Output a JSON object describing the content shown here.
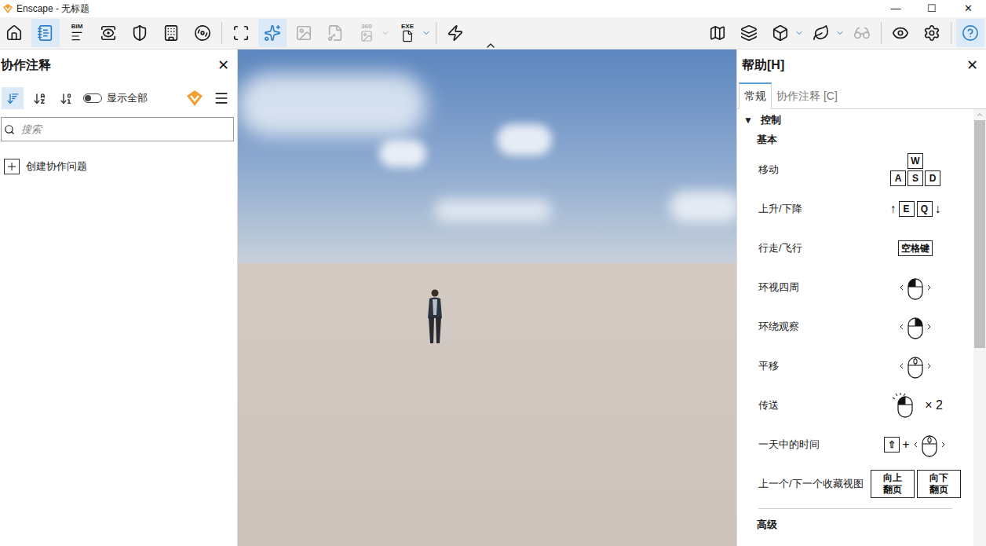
{
  "window": {
    "title": "Enscape - 无标题",
    "controls": [
      "—",
      "☐",
      "✕"
    ]
  },
  "toolbar": {
    "left": [
      [
        {
          "selected": false,
          "disabled": false,
          "dropdown": false
        },
        {
          "selected": true,
          "disabled": false,
          "dropdown": false
        },
        {
          "selected": false,
          "disabled": false,
          "dropdown": false,
          "label": "BIM"
        },
        {
          "selected": false,
          "disabled": false,
          "dropdown": false
        },
        {
          "selected": false,
          "disabled": false,
          "dropdown": false
        },
        {
          "selected": false,
          "disabled": false,
          "dropdown": false
        },
        {
          "selected": false,
          "disabled": false,
          "dropdown": false
        }
      ],
      [
        {
          "selected": false,
          "disabled": false,
          "dropdown": false
        },
        {
          "selected": true,
          "disabled": false,
          "dropdown": false
        },
        {
          "selected": false,
          "disabled": true,
          "dropdown": false
        },
        {
          "selected": false,
          "disabled": true,
          "dropdown": false
        },
        {
          "selected": false,
          "disabled": true,
          "dropdown": true,
          "label": "360"
        },
        {
          "selected": false,
          "disabled": false,
          "dropdown": true,
          "label": "EXE"
        }
      ],
      [
        {
          "selected": false,
          "disabled": false,
          "dropdown": false
        }
      ]
    ],
    "right": [
      [
        {
          "selected": false,
          "disabled": false,
          "dropdown": false
        },
        {
          "selected": false,
          "disabled": false,
          "dropdown": false
        },
        {
          "selected": false,
          "disabled": false,
          "dropdown": true
        },
        {
          "selected": false,
          "disabled": false,
          "dropdown": true
        },
        {
          "selected": false,
          "disabled": true,
          "dropdown": false
        }
      ],
      [
        {
          "selected": false,
          "disabled": false,
          "dropdown": false
        },
        {
          "selected": false,
          "disabled": false,
          "dropdown": false
        }
      ],
      [
        {
          "selected": true,
          "disabled": false,
          "dropdown": false
        }
      ]
    ]
  },
  "left_panel": {
    "title": "协作注释",
    "close": "✕",
    "sort": [
      {
        "selected": true
      },
      {
        "selected": false
      },
      {
        "selected": false
      }
    ],
    "show_all": {
      "label": "显示全部",
      "on": false
    },
    "search": {
      "placeholder": "搜索"
    },
    "create": "创建协作问题"
  },
  "help_panel": {
    "title": "帮助[H]",
    "close": "✕",
    "tabs": [
      {
        "label": "常规",
        "selected": true
      },
      {
        "label": "协作注释 [C]",
        "selected": false
      }
    ],
    "section": {
      "label": "控制",
      "marker": "▼",
      "expanded": true
    },
    "group": "基本",
    "rows": [
      {
        "label": "移动",
        "controls": [
          {
            "kind": "wasd",
            "top": "W",
            "bottom": [
              "A",
              "S",
              "D"
            ]
          }
        ]
      },
      {
        "label": "上升/下降",
        "controls": [
          {
            "kind": "text",
            "text": "↑"
          },
          {
            "kind": "key",
            "text": "E"
          },
          {
            "kind": "key",
            "text": "Q"
          },
          {
            "kind": "text",
            "text": "↓"
          }
        ]
      },
      {
        "label": "行走/飞行",
        "controls": [
          {
            "kind": "key",
            "text": "空格键"
          }
        ]
      },
      {
        "label": "环视四周",
        "controls": [
          {
            "kind": "mouse",
            "button": "left",
            "drag": true,
            "clicks": false
          }
        ]
      },
      {
        "label": "环绕观察",
        "controls": [
          {
            "kind": "mouse",
            "button": "right",
            "drag": true,
            "clicks": false
          }
        ]
      },
      {
        "label": "平移",
        "controls": [
          {
            "kind": "mouse",
            "button": "middle",
            "drag": true,
            "clicks": false
          }
        ]
      },
      {
        "label": "传送",
        "controls": [
          {
            "kind": "mouse",
            "button": "left",
            "drag": false,
            "clicks": true
          },
          {
            "kind": "text",
            "text": "× 2"
          }
        ]
      },
      {
        "label": "一天中的时间",
        "controls": [
          {
            "kind": "key",
            "text": "⇧"
          },
          {
            "kind": "text",
            "text": "+"
          },
          {
            "kind": "mouse",
            "button": "middle",
            "drag": true,
            "clicks": false
          }
        ]
      },
      {
        "label": "上一个/下一个收藏视图",
        "controls": [
          {
            "kind": "page-key",
            "text": "向上翻页"
          },
          {
            "kind": "page-key",
            "text": "向下翻页"
          }
        ]
      }
    ],
    "next_group": "高级"
  }
}
